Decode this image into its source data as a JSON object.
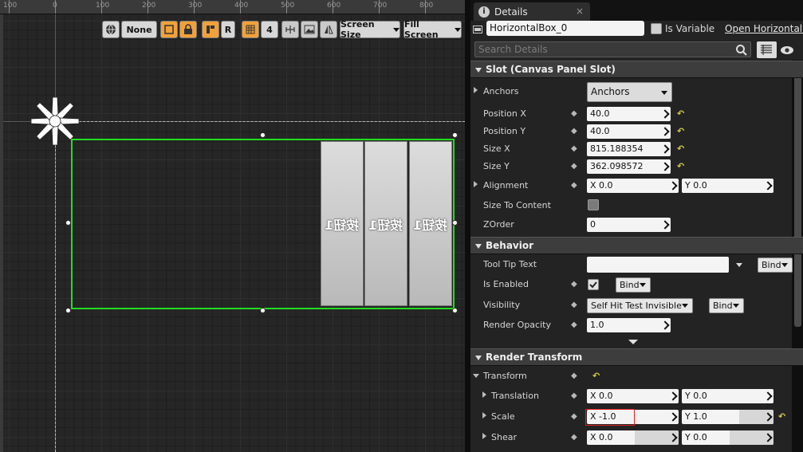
{
  "ruler": {
    "labels": [
      "100",
      "0",
      "100",
      "200",
      "300",
      "400",
      "500",
      "600",
      "700",
      "800"
    ]
  },
  "toolbar": {
    "dpi_label": "None",
    "r_label": "R",
    "grid_snap_value": "4",
    "screen_size_label": "Screen Size",
    "fill_screen_label": "Fill Screen"
  },
  "canvas": {
    "button_text": "按钮1",
    "outline_color": "#22dd22"
  },
  "details": {
    "tab_title": "Details",
    "tab_close": "×",
    "widget_name": "HorizontalBox_0",
    "is_variable_label": "Is Variable",
    "open_link": "Open HorizontalB",
    "search_placeholder": "Search Details",
    "slot_category": "Slot (Canvas Panel Slot)",
    "anchors_label": "Anchors",
    "anchors_value": "Anchors",
    "position_x_label": "Position X",
    "position_x": "40.0",
    "position_y_label": "Position Y",
    "position_y": "40.0",
    "size_x_label": "Size X",
    "size_x": "815.188354",
    "size_y_label": "Size Y",
    "size_y": "362.098572",
    "alignment_label": "Alignment",
    "alignment_x": "X  0.0",
    "alignment_y": "Y  0.0",
    "size_to_content_label": "Size To Content",
    "zorder_label": "ZOrder",
    "zorder": "0",
    "behavior_category": "Behavior",
    "tooltip_label": "Tool Tip Text",
    "bind_label": "Bind",
    "is_enabled_label": "Is Enabled",
    "visibility_label": "Visibility",
    "visibility_value": "Self Hit Test Invisible",
    "render_opacity_label": "Render Opacity",
    "render_opacity": "1.0",
    "render_transform_category": "Render Transform",
    "transform_label": "Transform",
    "translation_label": "Translation",
    "translation_x": "X  0.0",
    "translation_y": "Y  0.0",
    "scale_label": "Scale",
    "scale_x": "X  -1.0",
    "scale_y": "Y  1.0",
    "shear_label": "Shear",
    "shear_x": "X  0.0",
    "shear_y": "Y  0.0"
  }
}
